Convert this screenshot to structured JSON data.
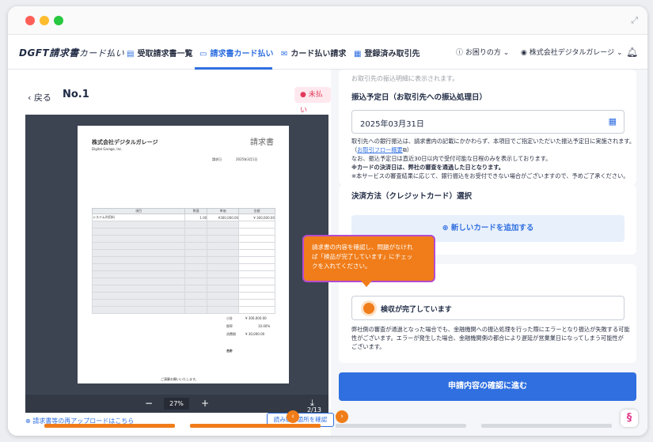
{
  "app": {
    "logo": "DGFT請求書",
    "logo_sub": "カード払い"
  },
  "nav": {
    "items": [
      {
        "label": "受取請求書一覧",
        "icon": "document-icon"
      },
      {
        "label": "請求書カード払い",
        "icon": "card-icon"
      },
      {
        "label": "カード払い請求",
        "icon": "mail-icon"
      },
      {
        "label": "登録済み取引先",
        "icon": "building-icon"
      }
    ],
    "help": "お困りの方",
    "company": "株式会社デジタルガレージ"
  },
  "left": {
    "back": "戻る",
    "invoice_no": "No.1",
    "status": "未払い",
    "doc": {
      "company": "株式会社デジタルガレージ",
      "company_en": "Digital Garage, Inc.",
      "stamp": "請求書",
      "date_label": "請求日",
      "date_value": "2025年3月1日",
      "col_item": "項目",
      "col_qty": "数量",
      "col_price": "単価",
      "col_amount": "金額",
      "row1_item": "システム利用料",
      "row1_qty": "1.00",
      "row1_price": "¥300,000.00",
      "row1_amount": "¥ 300,000.00",
      "subtotal_label": "小計",
      "subtotal_value": "¥ 300,000.00",
      "tax_rate_label": "税率",
      "tax_rate_value": "10.00%",
      "tax_label": "消費税",
      "tax_value": "¥ 30,000.00",
      "total_label": "合計",
      "closing": "ご清算お願いいたします。"
    },
    "zoom_minus": "−",
    "zoom_value": "27%",
    "zoom_plus": "+",
    "download": "⤓",
    "upload_link": "請求書等の再アップロードはこちら",
    "reupload_button": "読み取り箇所を確認"
  },
  "right": {
    "faded_top": "お取引先の振込明細に表示されます。",
    "date_label": "振込予定日（お取引先への振込処理日）",
    "date_value": "2025年03月31日",
    "note1": "取引先への銀行振込は、請求書内の記載にかかわらず、本項目でご指定いただいた振込予定日に実施されます。",
    "note2_pre": "（",
    "note2_link": "お取引フロー概要",
    "note2_post": "）",
    "note3": "なお、振込予定日は直近30日以内で受付可能な日程のみを表示しております。",
    "note4": "※カードの決済日は、弊社の審査を通過した日となります。",
    "note5": "※本サービスの審査結果に応じて、銀行振込をお受付できない場合がございますので、予めご了承ください。",
    "payment_label": "決済方法（クレジットカード）選択",
    "add_card": "新しいカードを追加する",
    "check_label": "検収が完了しています",
    "warn1": "弊社側の審査が通過となった場合でも、金融機関への振込処理を行った際にエラーとなり振込が失敗する可能",
    "warn2": "性がございます。エラーが発生した場合、金融機関側の都合により遅延が営業業日になってしまう可能性が",
    "warn3": "ございます。",
    "submit": "申請内容の確認に進む"
  },
  "tooltip": {
    "line1": "請求書の内容を確認し、問題がなけれ",
    "line2": "ば「検品が完了しています」にチェッ",
    "line3": "クを入れてください。"
  },
  "pager": {
    "prev": "‹",
    "count": "2/13",
    "next": "›"
  },
  "colors": {
    "accent": "#2f6fe0",
    "tooltip": "#f07d1a",
    "badge_text": "#e23a5b"
  }
}
